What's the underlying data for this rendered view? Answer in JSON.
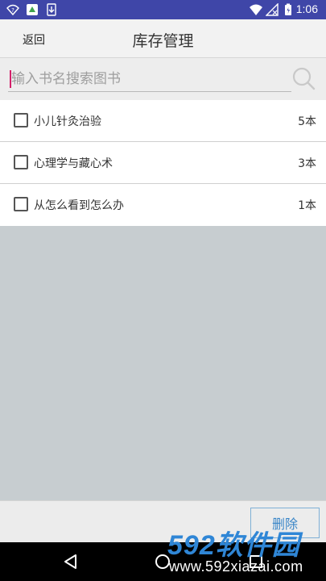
{
  "status_bar": {
    "time": "1:06",
    "left_icons": [
      "wifi-question-icon",
      "app-notification-icon",
      "download-icon"
    ],
    "right_icons": [
      "wifi-icon",
      "no-signal-icon",
      "battery-icon"
    ],
    "color": "#3f46a8"
  },
  "header": {
    "back_label": "返回",
    "title": "库存管理"
  },
  "search": {
    "placeholder": "输入书名搜索图书",
    "value": ""
  },
  "books": [
    {
      "title": "小儿针灸治验",
      "count": "5本",
      "checked": false
    },
    {
      "title": "心理学与藏心术",
      "count": "3本",
      "checked": false
    },
    {
      "title": "从怎么看到怎么办",
      "count": "1本",
      "checked": false
    }
  ],
  "footer": {
    "delete_label": "删除"
  },
  "navigation": {
    "buttons": [
      "back-icon",
      "home-icon",
      "recents-icon"
    ]
  },
  "watermark": {
    "logo_text": "592软件园",
    "url": "www.592xiazai.com"
  },
  "colors": {
    "accent": "#3a86c8",
    "caret": "#d4206a",
    "empty_area": "#c7cdd0"
  }
}
